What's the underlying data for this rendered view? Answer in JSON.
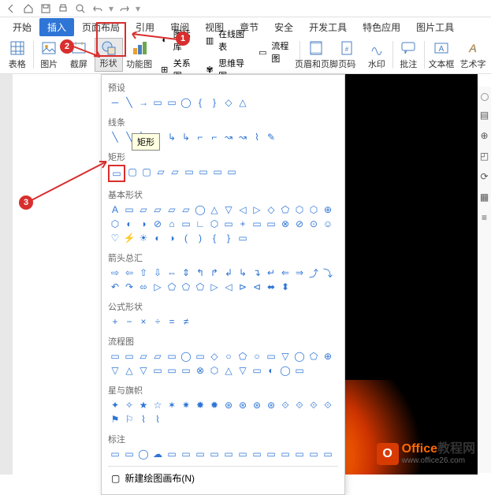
{
  "qat_icons": [
    "back",
    "home",
    "save",
    "print",
    "preview",
    "undo",
    "redo"
  ],
  "menus": [
    {
      "label": "开始",
      "active": false
    },
    {
      "label": "插入",
      "active": true
    },
    {
      "label": "页面布局",
      "active": false
    },
    {
      "label": "引用",
      "active": false
    },
    {
      "label": "审阅",
      "active": false
    },
    {
      "label": "视图",
      "active": false
    },
    {
      "label": "章节",
      "active": false
    },
    {
      "label": "安全",
      "active": false
    },
    {
      "label": "开发工具",
      "active": false
    },
    {
      "label": "特色应用",
      "active": false
    },
    {
      "label": "图片工具",
      "active": false
    }
  ],
  "ribbon_big": [
    {
      "label": "表格",
      "icon": "table"
    },
    {
      "label": "图片",
      "icon": "picture"
    },
    {
      "label": "截屏",
      "icon": "screenshot"
    },
    {
      "label": "形状",
      "icon": "shape",
      "selected": true
    },
    {
      "label": "功能图",
      "icon": "smartart"
    }
  ],
  "ribbon_stack": [
    {
      "label": "图标库",
      "icon": "iconlib"
    },
    {
      "label": "关系图",
      "icon": "relation"
    },
    {
      "label": "在线图表",
      "icon": "chart"
    },
    {
      "label": "思维导图",
      "icon": "mindmap"
    },
    {
      "label": "流程图",
      "icon": "flowchart"
    }
  ],
  "ribbon_right": [
    {
      "label": "页眉和页脚",
      "icon": "headerfooter"
    },
    {
      "label": "页码",
      "icon": "pagenum"
    },
    {
      "label": "水印",
      "icon": "watermark"
    },
    {
      "label": "批注",
      "icon": "comment"
    },
    {
      "label": "文本框",
      "icon": "textbox"
    },
    {
      "label": "艺术字",
      "icon": "wordart"
    }
  ],
  "sections": [
    {
      "title": "预设",
      "count": 10
    },
    {
      "title": "线条",
      "count": 12
    },
    {
      "title": "矩形",
      "count": 9,
      "sel": 0
    },
    {
      "title": "基本形状",
      "count": 42
    },
    {
      "title": "箭头总汇",
      "count": 29
    },
    {
      "title": "公式形状",
      "count": 6
    },
    {
      "title": "流程图",
      "count": 30
    },
    {
      "title": "星与旗帜",
      "count": 20
    },
    {
      "title": "标注",
      "count": 16
    }
  ],
  "footer_label": "新建绘图画布(N)",
  "tooltip_text": "矩形",
  "side_tools": [
    "layers",
    "zoom",
    "crop",
    "rotate",
    "template",
    "toc"
  ],
  "watermark": {
    "brand1": "Office",
    "brand2": "教程网",
    "url": "www.office26.com"
  },
  "annotations": {
    "a1": "1",
    "a2": "2",
    "a3": "3"
  }
}
